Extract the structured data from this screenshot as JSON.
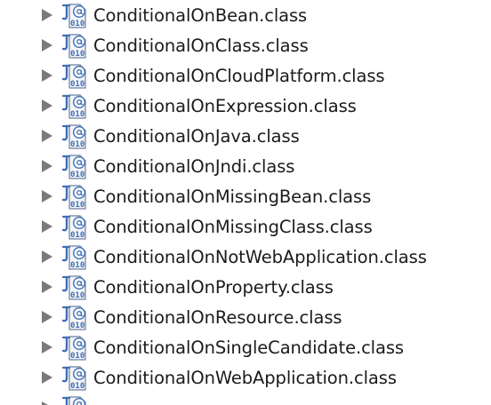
{
  "tree": {
    "items": [
      {
        "label": "ConditionalOnBean.class",
        "icon": "class-file-annotation-icon",
        "expanded": false
      },
      {
        "label": "ConditionalOnClass.class",
        "icon": "class-file-annotation-icon",
        "expanded": false
      },
      {
        "label": "ConditionalOnCloudPlatform.class",
        "icon": "class-file-annotation-icon",
        "expanded": false
      },
      {
        "label": "ConditionalOnExpression.class",
        "icon": "class-file-annotation-icon",
        "expanded": false
      },
      {
        "label": "ConditionalOnJava.class",
        "icon": "class-file-annotation-icon",
        "expanded": false
      },
      {
        "label": "ConditionalOnJndi.class",
        "icon": "class-file-annotation-icon",
        "expanded": false
      },
      {
        "label": "ConditionalOnMissingBean.class",
        "icon": "class-file-annotation-icon",
        "expanded": false
      },
      {
        "label": "ConditionalOnMissingClass.class",
        "icon": "class-file-annotation-icon",
        "expanded": false
      },
      {
        "label": "ConditionalOnNotWebApplication.class",
        "icon": "class-file-annotation-icon",
        "expanded": false
      },
      {
        "label": "ConditionalOnProperty.class",
        "icon": "class-file-annotation-icon",
        "expanded": false
      },
      {
        "label": "ConditionalOnResource.class",
        "icon": "class-file-annotation-icon",
        "expanded": false
      },
      {
        "label": "ConditionalOnSingleCandidate.class",
        "icon": "class-file-annotation-icon",
        "expanded": false
      },
      {
        "label": "ConditionalOnWebApplication.class",
        "icon": "class-file-annotation-icon",
        "expanded": false
      }
    ],
    "colors": {
      "text": "#1b1b1b",
      "twisty": "#7a7a7a",
      "icon_blue": "#3f6fb5",
      "icon_paper": "#f4f6f9"
    }
  }
}
